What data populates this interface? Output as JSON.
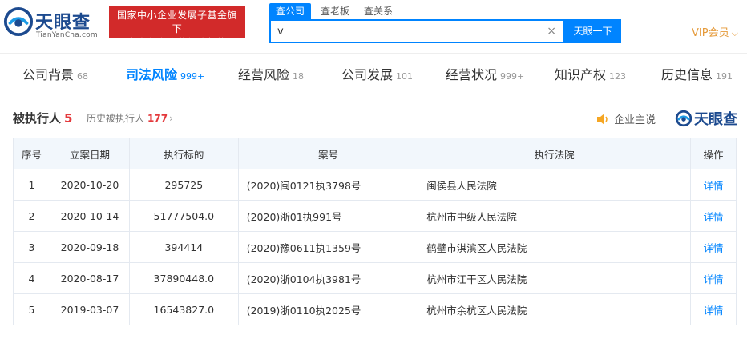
{
  "header": {
    "logo_text": "天眼查",
    "logo_sub": "TianYanCha.com",
    "gov_badge_line1": "国家中小企业发展子基金旗下",
    "gov_badge_line2": "官方备案企业征信机构",
    "search_tabs": [
      "查公司",
      "查老板",
      "查关系"
    ],
    "search_value": "v",
    "clear_symbol": "×",
    "search_button": "天眼一下",
    "vip_label": "VIP会员",
    "vip_chevron": "⌵"
  },
  "nav": [
    {
      "label": "公司背景",
      "count": "68"
    },
    {
      "label": "司法风险",
      "count": "999+"
    },
    {
      "label": "经营风险",
      "count": "18"
    },
    {
      "label": "公司发展",
      "count": "101"
    },
    {
      "label": "经营状况",
      "count": "999+"
    },
    {
      "label": "知识产权",
      "count": "123"
    },
    {
      "label": "历史信息",
      "count": "191"
    }
  ],
  "section": {
    "title": "被执行人",
    "count": "5",
    "history_label": "历史被执行人",
    "history_count": "177",
    "history_chevron": "›",
    "owner_say": "企业主说",
    "brand_text": "天眼查"
  },
  "colors": {
    "accent": "#0084ff",
    "brand_dark": "#1c4a8f",
    "badge_red": "#d22a2a",
    "count_red": "#e4393c",
    "vip_orange": "#e59a3a",
    "speaker_orange": "#f5a623"
  },
  "table": {
    "headers": [
      "序号",
      "立案日期",
      "执行标的",
      "案号",
      "执行法院",
      "操作"
    ],
    "rows": [
      [
        "1",
        "2020-10-20",
        "295725",
        "(2020)闽0121执3798号",
        "闽侯县人民法院",
        "详情"
      ],
      [
        "2",
        "2020-10-14",
        "51777504.0",
        "(2020)浙01执991号",
        "杭州市中级人民法院",
        "详情"
      ],
      [
        "3",
        "2020-09-18",
        "394414",
        "(2020)豫0611执1359号",
        "鹤壁市淇滨区人民法院",
        "详情"
      ],
      [
        "4",
        "2020-08-17",
        "37890448.0",
        "(2020)浙0104执3981号",
        "杭州市江干区人民法院",
        "详情"
      ],
      [
        "5",
        "2019-03-07",
        "16543827.0",
        "(2019)浙0110执2025号",
        "杭州市余杭区人民法院",
        "详情"
      ]
    ]
  }
}
